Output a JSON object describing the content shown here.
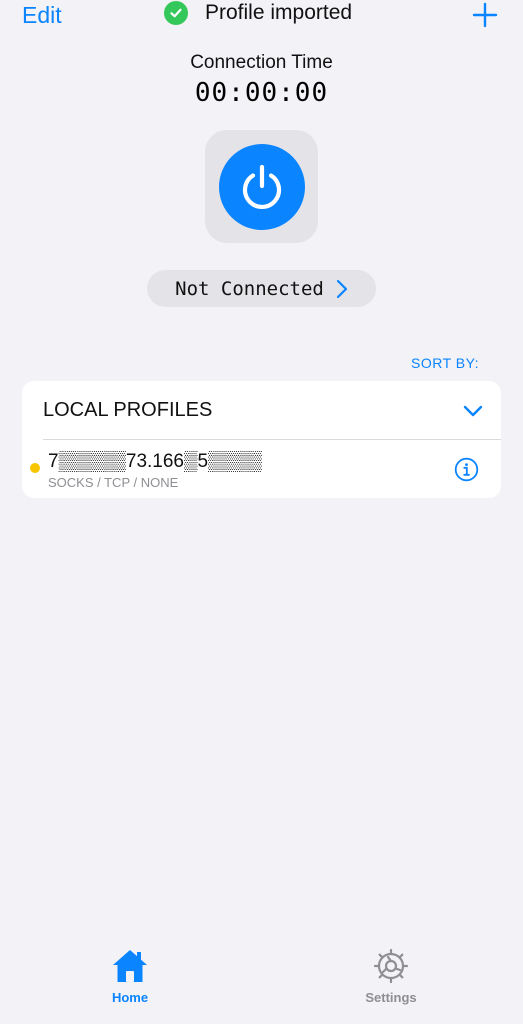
{
  "header": {
    "edit_label": "Edit",
    "toast_text": "Profile imported",
    "add_icon": "plus-icon",
    "toast_icon": "checkmark-circle-icon"
  },
  "connection": {
    "title": "Connection Time",
    "time": "00:00:00",
    "power_icon": "power-icon",
    "status": "Not Connected"
  },
  "sort": {
    "label": "SORT BY:"
  },
  "profiles": {
    "section_title": "LOCAL PROFILES",
    "items": [
      {
        "address": "7▒▒▒▒▒73.166▒5▒▒▒▒",
        "type": "SOCKS / TCP / NONE",
        "status_color": "#f7c600"
      }
    ]
  },
  "tabs": [
    {
      "label": "Home",
      "icon": "home-icon",
      "active": true
    },
    {
      "label": "Settings",
      "icon": "gear-icon",
      "active": false
    }
  ],
  "colors": {
    "accent": "#0a84ff",
    "background": "#f2f2f7",
    "success": "#34c759",
    "inactive": "#8e8e93"
  }
}
